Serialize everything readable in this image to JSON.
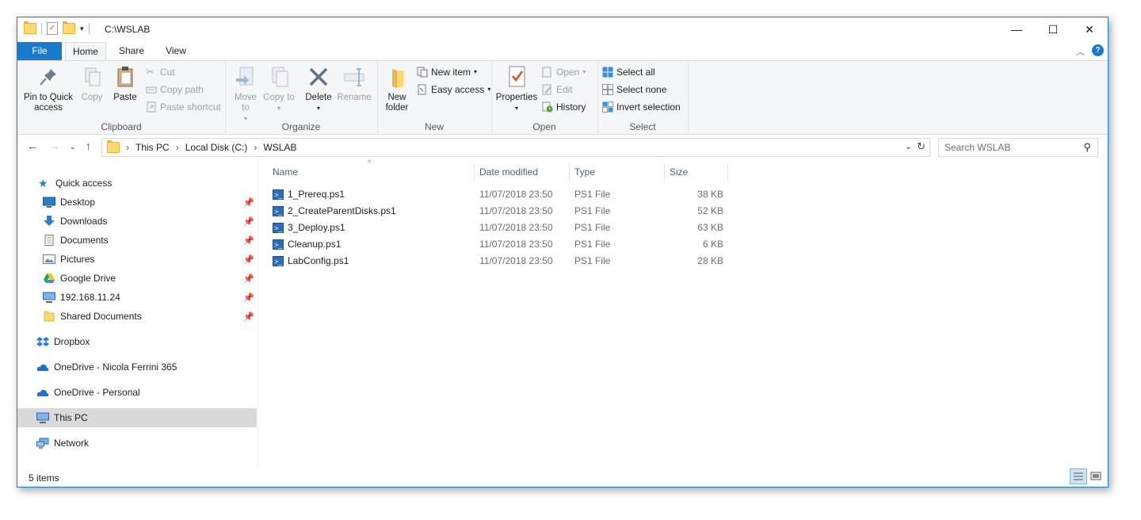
{
  "window": {
    "title": "C:\\WSLAB"
  },
  "tabs": [
    "File",
    "Home",
    "Share",
    "View"
  ],
  "ribbon": {
    "clipboard": {
      "label": "Clipboard",
      "pin": "Pin to Quick access",
      "copy": "Copy",
      "paste": "Paste",
      "cut": "Cut",
      "copy_path": "Copy path",
      "paste_shortcut": "Paste shortcut"
    },
    "organize": {
      "label": "Organize",
      "move_to": "Move to",
      "copy_to": "Copy to",
      "delete": "Delete",
      "rename": "Rename"
    },
    "new": {
      "label": "New",
      "new_folder": "New folder",
      "new_item": "New item",
      "easy_access": "Easy access"
    },
    "open": {
      "label": "Open",
      "properties": "Properties",
      "open": "Open",
      "edit": "Edit",
      "history": "History"
    },
    "select": {
      "label": "Select",
      "select_all": "Select all",
      "select_none": "Select none",
      "invert": "Invert selection"
    }
  },
  "address": {
    "crumbs": [
      "This PC",
      "Local Disk (C:)",
      "WSLAB"
    ],
    "search_placeholder": "Search WSLAB"
  },
  "nav": {
    "quick_access": "Quick access",
    "pinned": [
      "Desktop",
      "Downloads",
      "Documents",
      "Pictures",
      "Google Drive",
      "192.168.11.24",
      "Shared Documents"
    ],
    "dropbox": "Dropbox",
    "onedrive_business": "OneDrive - Nicola Ferrini 365",
    "onedrive_personal": "OneDrive - Personal",
    "this_pc": "This PC",
    "network": "Network"
  },
  "columns": {
    "name": "Name",
    "date": "Date modified",
    "type": "Type",
    "size": "Size"
  },
  "files": [
    {
      "name": "1_Prereq.ps1",
      "date": "11/07/2018 23:50",
      "type": "PS1 File",
      "size": "38 KB"
    },
    {
      "name": "2_CreateParentDisks.ps1",
      "date": "11/07/2018 23:50",
      "type": "PS1 File",
      "size": "52 KB"
    },
    {
      "name": "3_Deploy.ps1",
      "date": "11/07/2018 23:50",
      "type": "PS1 File",
      "size": "63 KB"
    },
    {
      "name": "Cleanup.ps1",
      "date": "11/07/2018 23:50",
      "type": "PS1 File",
      "size": "6 KB"
    },
    {
      "name": "LabConfig.ps1",
      "date": "11/07/2018 23:50",
      "type": "PS1 File",
      "size": "28 KB"
    }
  ],
  "status": {
    "count": "5 items"
  },
  "colors": {
    "accent": "#1979ca",
    "ps_blue": "#2d6fb6",
    "folder": "#ffd96b"
  }
}
